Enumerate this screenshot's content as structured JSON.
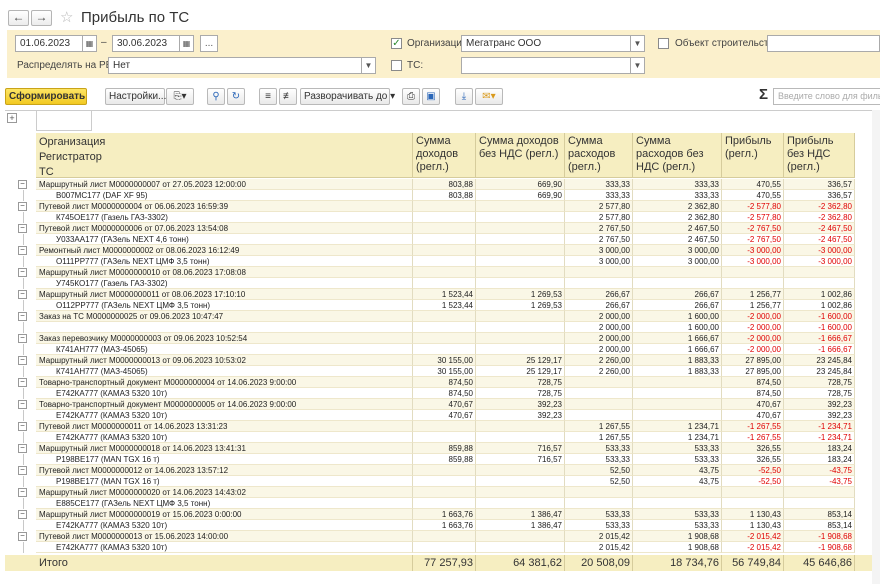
{
  "window": {
    "title": "Прибыль по ТС"
  },
  "filters": {
    "date_from": "01.06.2023",
    "date_sep": "–",
    "date_to": "30.06.2023",
    "period_btn": "...",
    "distribute_label": "Распределять на РБП:",
    "distribute_value": "Нет",
    "org_checked": true,
    "org_label": "Организация:",
    "org_value": "Мегатранс ООО",
    "construction_label": "Объект строительства:",
    "construction_value": "",
    "tc_label": "ТС:",
    "tc_value": ""
  },
  "toolbar": {
    "generate": "Сформировать",
    "settings": "Настройки...",
    "expand": "Разворачивать до",
    "search_placeholder": "Введите слово для фильтра",
    "sigma": "Σ"
  },
  "icons": [
    "back-icon",
    "forward-icon",
    "star-icon",
    "calendar-icon",
    "chevron-down-icon",
    "copy-icon",
    "search-icon",
    "search-reset-icon",
    "sort-asc-icon",
    "sort-desc-icon",
    "print-icon",
    "preview-icon",
    "download-icon",
    "mail-icon",
    "tree-collapse-icon"
  ],
  "report": {
    "headers": {
      "group_col": [
        "Организация",
        "Регистратор",
        "ТС"
      ],
      "income": "Сумма доходов (регл.)",
      "income_novat": "Сумма доходов без НДС (регл.)",
      "expense": "Сумма расходов (регл.)",
      "expense_novat": "Сумма расходов без НДС (регл.)",
      "profit": "Прибыль (регл.)",
      "profit_novat": "Прибыль без НДС (регл.)"
    },
    "rows": [
      {
        "t": "doc",
        "name": "Маршрутный лист М0000000007 от 27.05.2023 12:00:00",
        "v": [
          "803,88",
          "669,90",
          "333,33",
          "333,33",
          "470,55",
          "336,57"
        ]
      },
      {
        "t": "veh",
        "name": "В007МС177 (DAF XF 95)",
        "v": [
          "803,88",
          "669,90",
          "333,33",
          "333,33",
          "470,55",
          "336,57"
        ]
      },
      {
        "t": "doc",
        "name": "Путевой лист М0000000004 от 06.06.2023 16:59:39",
        "v": [
          "",
          "",
          "2 577,80",
          "2 362,80",
          "-2 577,80",
          "-2 362,80"
        ]
      },
      {
        "t": "veh",
        "name": "К745ОЕ177 (Газель ГАЗ-3302)",
        "v": [
          "",
          "",
          "2 577,80",
          "2 362,80",
          "-2 577,80",
          "-2 362,80"
        ]
      },
      {
        "t": "doc",
        "name": "Путевой лист М0000000006 от 07.06.2023 13:54:08",
        "v": [
          "",
          "",
          "2 767,50",
          "2 467,50",
          "-2 767,50",
          "-2 467,50"
        ]
      },
      {
        "t": "veh",
        "name": "У033АА177 (ГАЗель NEXT 4,6 тонн)",
        "v": [
          "",
          "",
          "2 767,50",
          "2 467,50",
          "-2 767,50",
          "-2 467,50"
        ]
      },
      {
        "t": "doc",
        "name": "Ремонтный лист М0000000002 от 08.06.2023 16:12:49",
        "v": [
          "",
          "",
          "3 000,00",
          "3 000,00",
          "-3 000,00",
          "-3 000,00"
        ]
      },
      {
        "t": "veh",
        "name": "О111РР777 (ГАЗель NEXT ЦМФ 3,5 тонн)",
        "v": [
          "",
          "",
          "3 000,00",
          "3 000,00",
          "-3 000,00",
          "-3 000,00"
        ]
      },
      {
        "t": "doc",
        "name": "Маршрутный лист М0000000010 от 08.06.2023 17:08:08",
        "v": [
          "",
          "",
          "",
          "",
          "",
          ""
        ]
      },
      {
        "t": "veh",
        "name": "У745КО177 (Газель ГАЗ-3302)",
        "v": [
          "",
          "",
          "",
          "",
          "",
          ""
        ]
      },
      {
        "t": "doc",
        "name": "Маршрутный лист М0000000011 от 08.06.2023 17:10:10",
        "v": [
          "1 523,44",
          "1 269,53",
          "266,67",
          "266,67",
          "1 256,77",
          "1 002,86"
        ]
      },
      {
        "t": "veh",
        "name": "О112РР777 (ГАЗель NEXT ЦМФ 3,5 тонн)",
        "v": [
          "1 523,44",
          "1 269,53",
          "266,67",
          "266,67",
          "1 256,77",
          "1 002,86"
        ]
      },
      {
        "t": "doc",
        "name": "Заказ на ТС М0000000025 от 09.06.2023 10:47:47",
        "v": [
          "",
          "",
          "2 000,00",
          "1 600,00",
          "-2 000,00",
          "-1 600,00"
        ]
      },
      {
        "t": "veh",
        "name": "",
        "v": [
          "",
          "",
          "2 000,00",
          "1 600,00",
          "-2 000,00",
          "-1 600,00"
        ]
      },
      {
        "t": "doc",
        "name": "Заказ перевозчику М0000000003 от 09.06.2023 10:52:54",
        "v": [
          "",
          "",
          "2 000,00",
          "1 666,67",
          "-2 000,00",
          "-1 666,67"
        ]
      },
      {
        "t": "veh",
        "name": "К741АН777 (МАЗ-45065)",
        "v": [
          "",
          "",
          "2 000,00",
          "1 666,67",
          "-2 000,00",
          "-1 666,67"
        ]
      },
      {
        "t": "doc",
        "name": "Маршрутный лист М0000000013 от 09.06.2023 10:53:02",
        "v": [
          "30 155,00",
          "25 129,17",
          "2 260,00",
          "1 883,33",
          "27 895,00",
          "23 245,84"
        ]
      },
      {
        "t": "veh",
        "name": "К741АН777 (МАЗ-45065)",
        "v": [
          "30 155,00",
          "25 129,17",
          "2 260,00",
          "1 883,33",
          "27 895,00",
          "23 245,84"
        ]
      },
      {
        "t": "doc",
        "name": "Товарно-транспортный документ М0000000004 от 14.06.2023 9:00:00",
        "v": [
          "874,50",
          "728,75",
          "",
          "",
          "874,50",
          "728,75"
        ]
      },
      {
        "t": "veh",
        "name": "Е742КА777 (КАМАЗ 5320 10т)",
        "v": [
          "874,50",
          "728,75",
          "",
          "",
          "874,50",
          "728,75"
        ]
      },
      {
        "t": "doc",
        "name": "Товарно-транспортный документ М0000000005 от 14.06.2023 9:00:00",
        "v": [
          "470,67",
          "392,23",
          "",
          "",
          "470,67",
          "392,23"
        ]
      },
      {
        "t": "veh",
        "name": "Е742КА777 (КАМАЗ 5320 10т)",
        "v": [
          "470,67",
          "392,23",
          "",
          "",
          "470,67",
          "392,23"
        ]
      },
      {
        "t": "doc",
        "name": "Путевой лист М0000000011 от 14.06.2023 13:31:23",
        "v": [
          "",
          "",
          "1 267,55",
          "1 234,71",
          "-1 267,55",
          "-1 234,71"
        ]
      },
      {
        "t": "veh",
        "name": "Е742КА777 (КАМАЗ 5320 10т)",
        "v": [
          "",
          "",
          "1 267,55",
          "1 234,71",
          "-1 267,55",
          "-1 234,71"
        ]
      },
      {
        "t": "doc",
        "name": "Маршрутный лист М0000000018 от 14.06.2023 13:41:31",
        "v": [
          "859,88",
          "716,57",
          "533,33",
          "533,33",
          "326,55",
          "183,24"
        ]
      },
      {
        "t": "veh",
        "name": "Р198ВЕ177 (MAN TGX 16 т)",
        "v": [
          "859,88",
          "716,57",
          "533,33",
          "533,33",
          "326,55",
          "183,24"
        ]
      },
      {
        "t": "doc",
        "name": "Путевой лист М0000000012 от 14.06.2023 13:57:12",
        "v": [
          "",
          "",
          "52,50",
          "43,75",
          "-52,50",
          "-43,75"
        ]
      },
      {
        "t": "veh",
        "name": "Р198ВЕ177 (MAN TGX 16 т)",
        "v": [
          "",
          "",
          "52,50",
          "43,75",
          "-52,50",
          "-43,75"
        ]
      },
      {
        "t": "doc",
        "name": "Маршрутный лист М0000000020 от 14.06.2023 14:43:02",
        "v": [
          "",
          "",
          "",
          "",
          "",
          ""
        ]
      },
      {
        "t": "veh",
        "name": "Е885СЕ177 (ГАЗель NEXT ЦМФ 3,5 тонн)",
        "v": [
          "",
          "",
          "",
          "",
          "",
          ""
        ]
      },
      {
        "t": "doc",
        "name": "Маршрутный лист М0000000019 от 15.06.2023 0:00:00",
        "v": [
          "1 663,76",
          "1 386,47",
          "533,33",
          "533,33",
          "1 130,43",
          "853,14"
        ]
      },
      {
        "t": "veh",
        "name": "Е742КА777 (КАМАЗ 5320 10т)",
        "v": [
          "1 663,76",
          "1 386,47",
          "533,33",
          "533,33",
          "1 130,43",
          "853,14"
        ]
      },
      {
        "t": "doc",
        "name": "Путевой лист М0000000013 от 15.06.2023 14:00:00",
        "v": [
          "",
          "",
          "2 015,42",
          "1 908,68",
          "-2 015,42",
          "-1 908,68"
        ]
      },
      {
        "t": "veh",
        "name": "Е742КА777 (КАМАЗ 5320 10т)",
        "v": [
          "",
          "",
          "2 015,42",
          "1 908,68",
          "-2 015,42",
          "-1 908,68"
        ]
      }
    ],
    "total": {
      "label": "Итого",
      "v": [
        "77 257,93",
        "64 381,62",
        "20 508,09",
        "18 734,76",
        "56 749,84",
        "45 646,86"
      ]
    }
  }
}
